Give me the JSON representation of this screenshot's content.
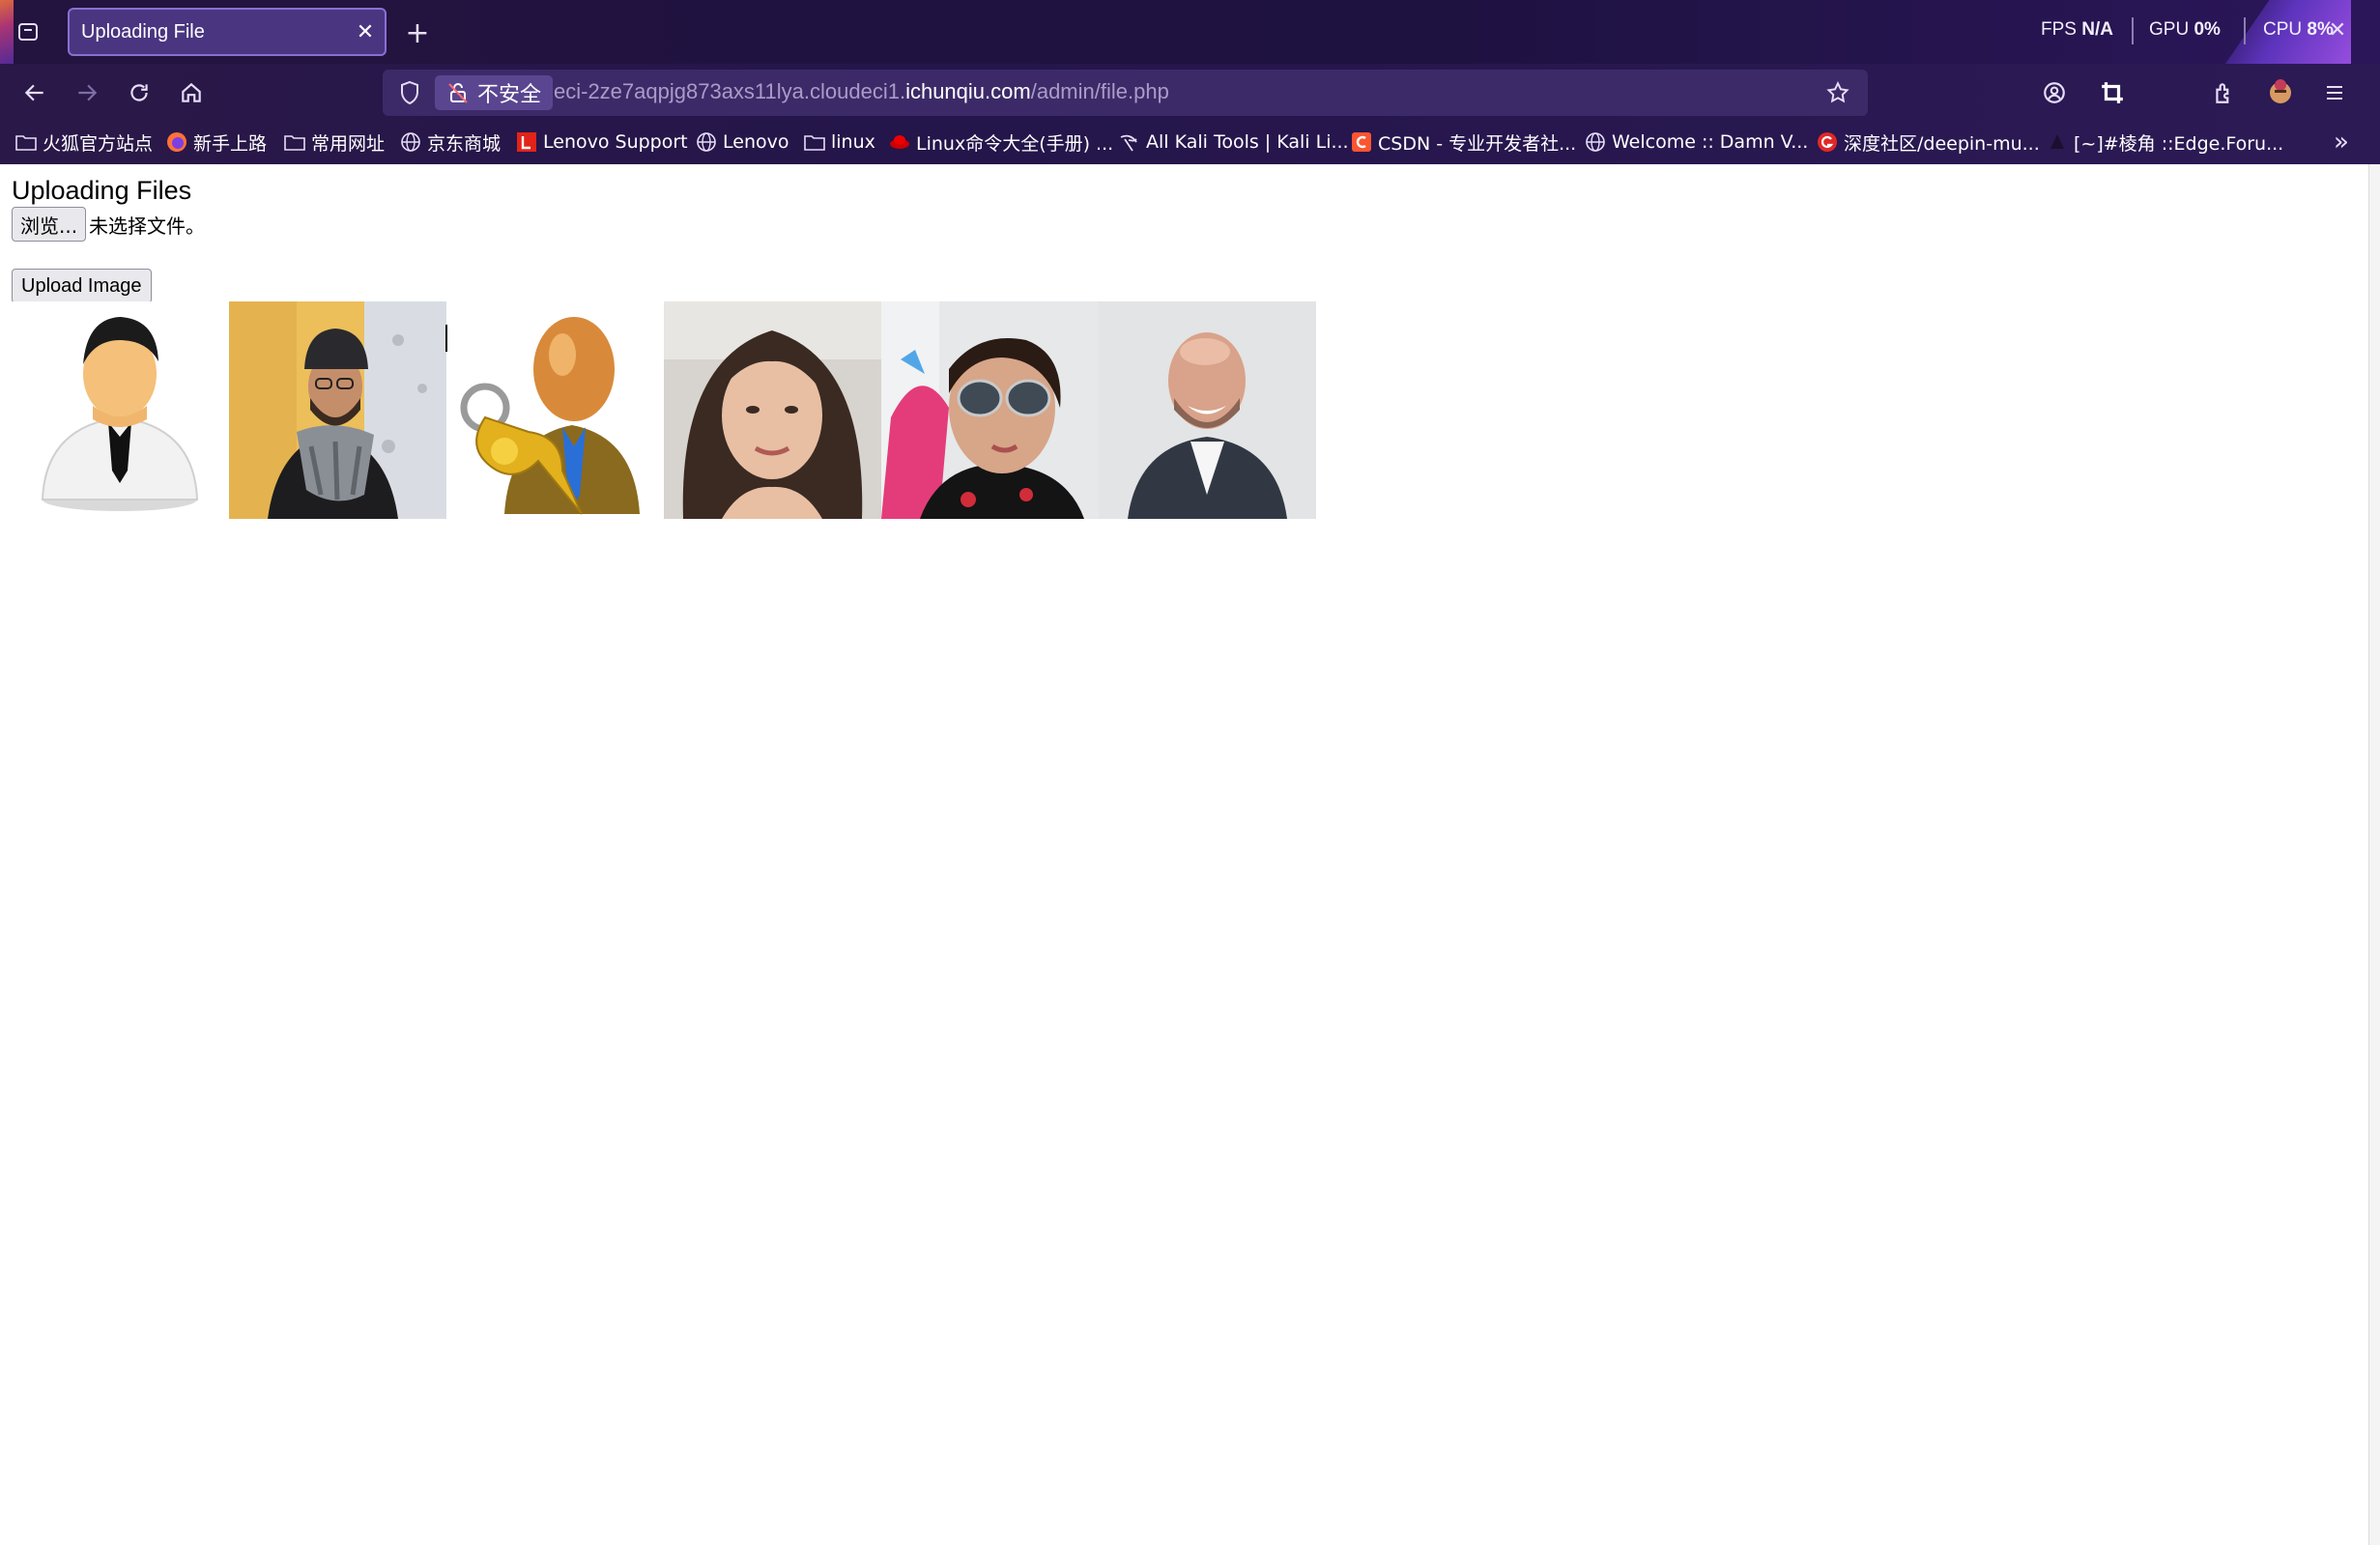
{
  "tab": {
    "title": "Uploading File",
    "close": "✕",
    "new_tab": "+"
  },
  "perf": {
    "fps_label": "FPS",
    "fps_value": "N/A",
    "gpu_label": "GPU",
    "gpu_value": "0%",
    "cpu_label": "CPU",
    "cpu_value": "8%"
  },
  "address": {
    "security_label": "不安全",
    "url_prefix": "eci-2ze7aqpjg873axs11lya.cloudeci1.",
    "url_host": "ichunqiu.com",
    "url_path": "/admin/file.php"
  },
  "bookmarks": [
    {
      "label": "火狐官方站点",
      "icon": "folder-icon"
    },
    {
      "label": "新手上路",
      "icon": "firefox-icon"
    },
    {
      "label": "常用网址",
      "icon": "folder-icon"
    },
    {
      "label": "京东商城",
      "icon": "globe-icon"
    },
    {
      "label": "Lenovo Support",
      "icon": "lenovo-icon"
    },
    {
      "label": "Lenovo",
      "icon": "globe-icon"
    },
    {
      "label": "linux",
      "icon": "folder-icon"
    },
    {
      "label": "Linux命令大全(手册) ...",
      "icon": "redhat-icon"
    },
    {
      "label": "All Kali Tools | Kali Li...",
      "icon": "kali-icon"
    },
    {
      "label": "CSDN - 专业开发者社...",
      "icon": "csdn-icon"
    },
    {
      "label": "Welcome :: Damn V...",
      "icon": "globe-icon"
    },
    {
      "label": "深度社区/deepin-mu...",
      "icon": "deepin-icon"
    },
    {
      "label": "[~]#棱角 ::Edge.Foru...",
      "icon": "edge-forum-icon"
    }
  ],
  "page": {
    "heading": "Uploading Files",
    "browse_label": "浏览...",
    "file_status": "未选择文件。",
    "upload_label": "Upload Image"
  },
  "images": [
    {
      "name": "user-tie-avatar-image"
    },
    {
      "name": "bearded-man-scarf-photo"
    },
    {
      "name": "user-key-avatar-image"
    },
    {
      "name": "smiling-woman-photo"
    },
    {
      "name": "sunglasses-woman-photo"
    },
    {
      "name": "laughing-bald-man-photo"
    }
  ],
  "colors": {
    "chrome": "#24154a",
    "tab_active": "#4a3580",
    "urlbar": "#3c2a68"
  }
}
